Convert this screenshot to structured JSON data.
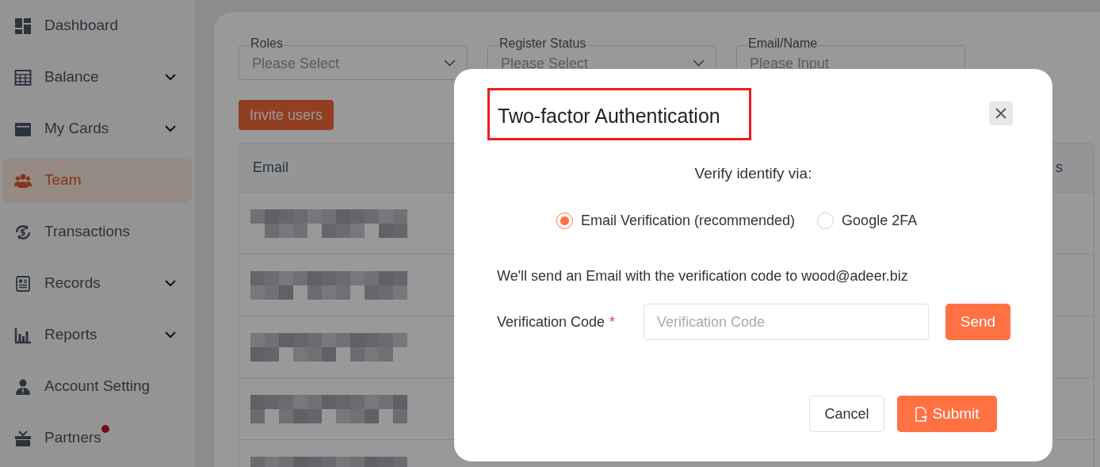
{
  "sidebar": {
    "items": [
      {
        "label": "Dashboard",
        "expandable": false,
        "selected": false,
        "badge": false
      },
      {
        "label": "Balance",
        "expandable": true,
        "selected": false,
        "badge": false
      },
      {
        "label": "My Cards",
        "expandable": true,
        "selected": false,
        "badge": false
      },
      {
        "label": "Team",
        "expandable": false,
        "selected": true,
        "badge": false
      },
      {
        "label": "Transactions",
        "expandable": false,
        "selected": false,
        "badge": false
      },
      {
        "label": "Records",
        "expandable": true,
        "selected": false,
        "badge": false
      },
      {
        "label": "Reports",
        "expandable": true,
        "selected": false,
        "badge": false
      },
      {
        "label": "Account Setting",
        "expandable": false,
        "selected": false,
        "badge": false
      },
      {
        "label": "Partners",
        "expandable": false,
        "selected": false,
        "badge": true
      }
    ]
  },
  "filters": [
    {
      "label": "Roles",
      "placeholder": "Please Select",
      "kind": "select"
    },
    {
      "label": "Register Status",
      "placeholder": "Please Select",
      "kind": "select"
    },
    {
      "label": "Email/Name",
      "placeholder": "Please Input",
      "kind": "input"
    }
  ],
  "invite_button": "Invite users",
  "table": {
    "columns": [
      "Email",
      "s"
    ]
  },
  "dialog": {
    "title": "Two-factor Authentication",
    "prompt": "Verify identify via:",
    "options": [
      {
        "label": "Email Verification (recommended)",
        "selected": true
      },
      {
        "label": "Google 2FA",
        "selected": false
      }
    ],
    "message": "We'll send an Email with the verification code to wood@adeer.biz",
    "code_label": "Verification Code",
    "required_mark": "*",
    "code_placeholder": "Verification Code",
    "send_button": "Send",
    "cancel_button": "Cancel",
    "submit_button": "Submit"
  }
}
